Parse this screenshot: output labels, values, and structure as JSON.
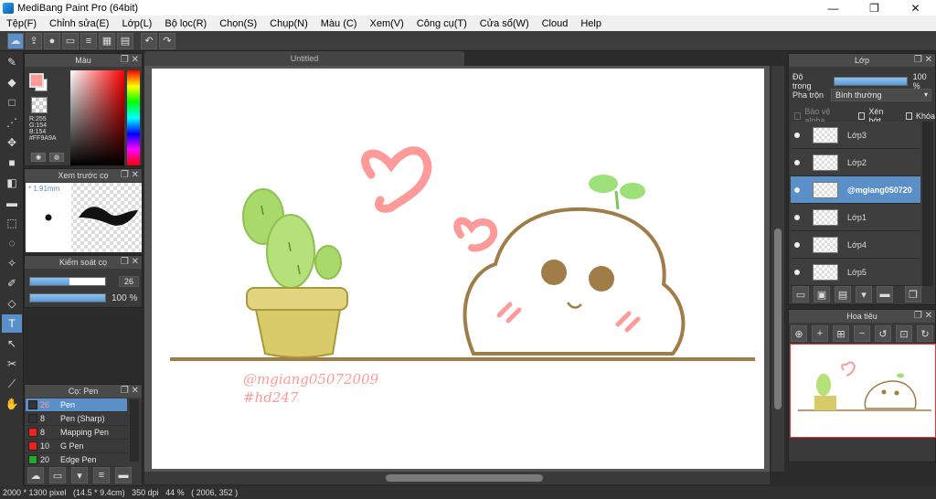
{
  "window": {
    "title": "MediBang Paint Pro (64bit)",
    "buttons": [
      "—",
      "❐",
      "✕"
    ]
  },
  "menu": [
    "Tệp(F)",
    "Chỉnh sửa(E)",
    "Lớp(L)",
    "Bộ lọc(R)",
    "Chọn(S)",
    "Chụp(N)",
    "Màu (C)",
    "Xem(V)",
    "Công cụ(T)",
    "Cửa sổ(W)",
    "Cloud",
    "Help"
  ],
  "toolbar": {
    "icons": [
      "cloud-icon",
      "upload-icon",
      "chat-icon",
      "page-icon",
      "note-icon",
      "grid-icon",
      "apps-icon",
      "undo-icon",
      "redo-icon"
    ]
  },
  "canvas": {
    "tab_title": "Untitled",
    "watermark_line1": "@mgiang05072009",
    "watermark_line2": "#hd247"
  },
  "color_panel": {
    "title": "Màu",
    "fg_color": "#FF9A9A",
    "r": "R:255",
    "g": "G:154",
    "b": "B:154",
    "hex": "#FF9A9A"
  },
  "brush_preview": {
    "title": "Xem trước cọ",
    "size": "* 1.91mm"
  },
  "brush_control": {
    "title": "Kiểm soát cọ",
    "size_value": "26",
    "size_level": 0.52,
    "opacity_value": "100 %",
    "opacity_level": 1.0
  },
  "brush_list": {
    "title": "Cọ: Pen",
    "items": [
      {
        "size": "26",
        "name": "Pen",
        "color": "#333333",
        "selected": true
      },
      {
        "size": "8",
        "name": "Pen (Sharp)",
        "color": "#333333",
        "selected": false
      },
      {
        "size": "8",
        "name": "Mapping Pen",
        "color": "#ee2222",
        "selected": false
      },
      {
        "size": "10",
        "name": "G Pen",
        "color": "#ee2222",
        "selected": false
      },
      {
        "size": "20",
        "name": "Edge Pen",
        "color": "#22aa22",
        "selected": false
      }
    ]
  },
  "layers": {
    "title": "Lớp",
    "opacity_label": "Độ trong",
    "opacity_value": "100 %",
    "opacity_level": 1.0,
    "blend_label": "Pha trộn",
    "blend_value": "Bình thường",
    "protect_alpha": "Bảo vệ alpha",
    "clipping": "Xén bớt",
    "lock": "Khóa",
    "items": [
      {
        "name": "Lớp3",
        "selected": false
      },
      {
        "name": "Lớp2",
        "selected": false
      },
      {
        "name": "@mgiang050720",
        "selected": true
      },
      {
        "name": "Lớp1",
        "selected": false
      },
      {
        "name": "Lớp4",
        "selected": false
      },
      {
        "name": "Lớp5",
        "selected": false
      }
    ]
  },
  "navigator": {
    "title": "Hoa tiêu"
  },
  "status": {
    "text": "2000 * 1300 pixel   (14.5 * 9.4cm)   350 dpi   44 %   ( 2006, 352 )"
  }
}
